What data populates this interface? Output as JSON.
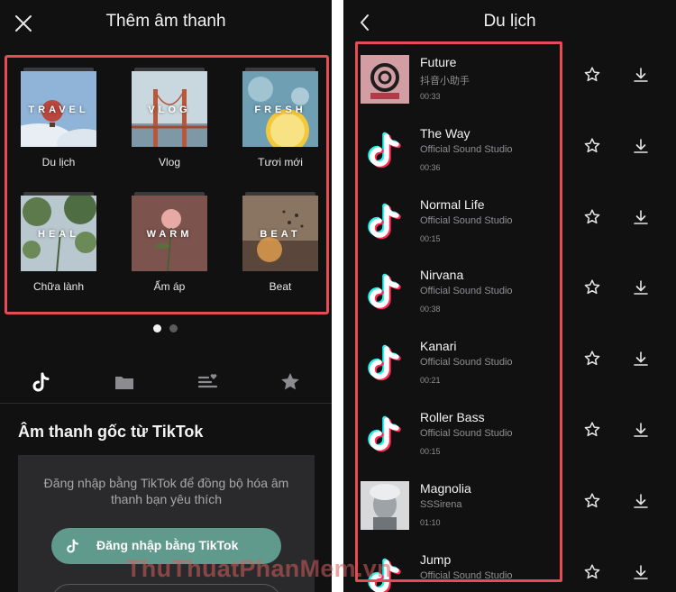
{
  "left": {
    "title": "Thêm âm thanh",
    "close_icon": "close-icon",
    "categories": [
      {
        "word": "TRAVEL",
        "label": "Du lịch"
      },
      {
        "word": "VLOG",
        "label": "Vlog"
      },
      {
        "word": "FRESH",
        "label": "Tươi mới"
      },
      {
        "word": "HEAL",
        "label": "Chữa lành"
      },
      {
        "word": "WARM",
        "label": "Ấm áp"
      },
      {
        "word": "BEAT",
        "label": "Beat"
      }
    ],
    "page_dots": {
      "count": 2,
      "active": 1
    },
    "tabs": [
      "tiktok-icon",
      "folder-icon",
      "playlist-favorite-icon",
      "star-icon"
    ],
    "section_title": "Âm thanh gốc từ TikTok",
    "login_text": "Đăng nhập bằng TikTok để đồng bộ hóa âm thanh bạn yêu thích",
    "login_button": "Đăng nhập bằng TikTok"
  },
  "right": {
    "title": "Du lịch",
    "back_icon": "chevron-left-icon",
    "tracks": [
      {
        "title": "Future",
        "artist": "抖音小助手",
        "duration": "00:33",
        "thumb": "douyin"
      },
      {
        "title": "The Way",
        "artist": "Official Sound Studio",
        "duration": "00:36",
        "thumb": "tiktok"
      },
      {
        "title": "Normal Life",
        "artist": "Official Sound Studio",
        "duration": "00:15",
        "thumb": "tiktok"
      },
      {
        "title": "Nirvana",
        "artist": "Official Sound Studio",
        "duration": "00:38",
        "thumb": "tiktok"
      },
      {
        "title": "Kanari",
        "artist": "Official Sound Studio",
        "duration": "00:21",
        "thumb": "tiktok"
      },
      {
        "title": "Roller Bass",
        "artist": "Official Sound Studio",
        "duration": "00:15",
        "thumb": "tiktok"
      },
      {
        "title": "Magnolia",
        "artist": "SSSirena",
        "duration": "01:10",
        "thumb": "portrait"
      },
      {
        "title": "Jump",
        "artist": "Official Sound Studio",
        "duration": "",
        "thumb": "tiktok"
      }
    ]
  },
  "watermark": "ThuThuatPhanMem.vn",
  "colors": {
    "highlight": "#e84b52",
    "button": "#5f9a8c",
    "background": "#111112"
  }
}
